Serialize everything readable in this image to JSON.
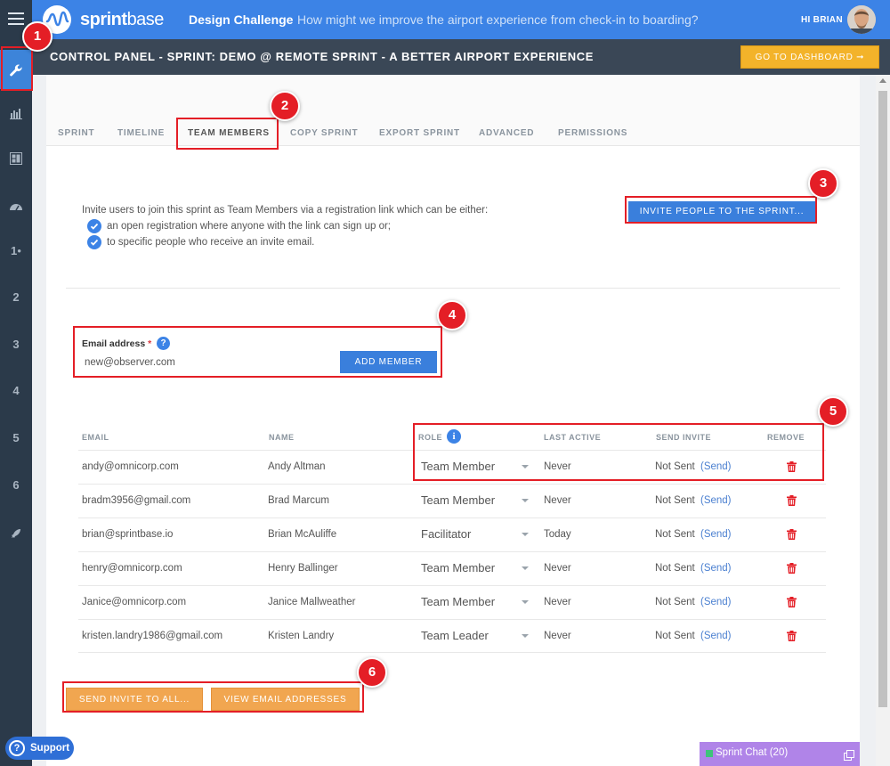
{
  "app": {
    "logo_name": "sprint",
    "logo_name_light": "base",
    "challenge_label": "Design Challenge",
    "challenge_text": "How might we improve the airport experience from check-in to boarding?",
    "greeting": "HI BRIAN"
  },
  "rail": {
    "items": [
      {
        "icon": "wrench-icon",
        "label": ""
      },
      {
        "icon": "bar-chart-icon",
        "label": ""
      },
      {
        "icon": "board-icon",
        "label": ""
      },
      {
        "icon": "gauge-icon",
        "label": ""
      },
      {
        "label": "1"
      },
      {
        "label": "2"
      },
      {
        "label": "3"
      },
      {
        "label": "4"
      },
      {
        "label": "5"
      },
      {
        "label": "6"
      },
      {
        "icon": "rocket-icon",
        "label": ""
      }
    ]
  },
  "header": {
    "title": "CONTROL PANEL - SPRINT: DEMO @ REMOTE SPRINT - A BETTER AIRPORT EXPERIENCE",
    "dashboard_button": "GO TO DASHBOARD ➞"
  },
  "tabs": [
    "SPRINT",
    "TIMELINE",
    "TEAM MEMBERS",
    "COPY SPRINT",
    "EXPORT SPRINT",
    "ADVANCED",
    "PERMISSIONS"
  ],
  "active_tab": "TEAM MEMBERS",
  "invite": {
    "intro": "Invite users to join this sprint as Team Members via a registration link which can be either:",
    "option1": "an open registration where anyone with the link can sign up or;",
    "option2": "to specific people who receive an invite email.",
    "button": "INVITE PEOPLE TO THE SPRINT..."
  },
  "add_member": {
    "label": "Email address",
    "required_mark": "*",
    "help": "?",
    "value": "new@observer.com",
    "button": "ADD MEMBER"
  },
  "table": {
    "headers": {
      "email": "EMAIL",
      "name": "NAME",
      "role": "ROLE",
      "last_active": "LAST ACTIVE",
      "send_invite": "SEND INVITE",
      "remove": "REMOVE"
    },
    "info": "i",
    "send_link": "(Send)",
    "rows": [
      {
        "email": "andy@omnicorp.com",
        "name": "Andy Altman",
        "role": "Team Member",
        "last_active": "Never",
        "status": "Not Sent"
      },
      {
        "email": "bradm3956@gmail.com",
        "name": "Brad Marcum",
        "role": "Team Member",
        "last_active": "Never",
        "status": "Not Sent"
      },
      {
        "email": "brian@sprintbase.io",
        "name": "Brian McAuliffe",
        "role": "Facilitator",
        "last_active": "Today",
        "status": "Not Sent"
      },
      {
        "email": "henry@omnicorp.com",
        "name": "Henry Ballinger",
        "role": "Team Member",
        "last_active": "Never",
        "status": "Not Sent"
      },
      {
        "email": "Janice@omnicorp.com",
        "name": "Janice Mallweather",
        "role": "Team Member",
        "last_active": "Never",
        "status": "Not Sent"
      },
      {
        "email": "kristen.landry1986@gmail.com",
        "name": "Kristen Landry",
        "role": "Team Leader",
        "last_active": "Never",
        "status": "Not Sent"
      }
    ]
  },
  "footer_buttons": {
    "send_all": "SEND INVITE TO ALL...",
    "view_emails": "VIEW EMAIL ADDRESSES"
  },
  "support": {
    "label": "Support",
    "icon": "?"
  },
  "chat": {
    "label": "Sprint Chat (20)"
  },
  "annotations": [
    "1",
    "2",
    "3",
    "4",
    "5",
    "6"
  ],
  "colors": {
    "brand_blue": "#3c83e6",
    "header_dark": "#3a4756",
    "rail_dark": "#2b3a4a",
    "dashboard_yellow": "#f3b32a",
    "action_orange": "#f1a650",
    "remove_red": "#e41e26",
    "chat_purple": "#b084e8",
    "annotation_red": "#e41e26"
  }
}
